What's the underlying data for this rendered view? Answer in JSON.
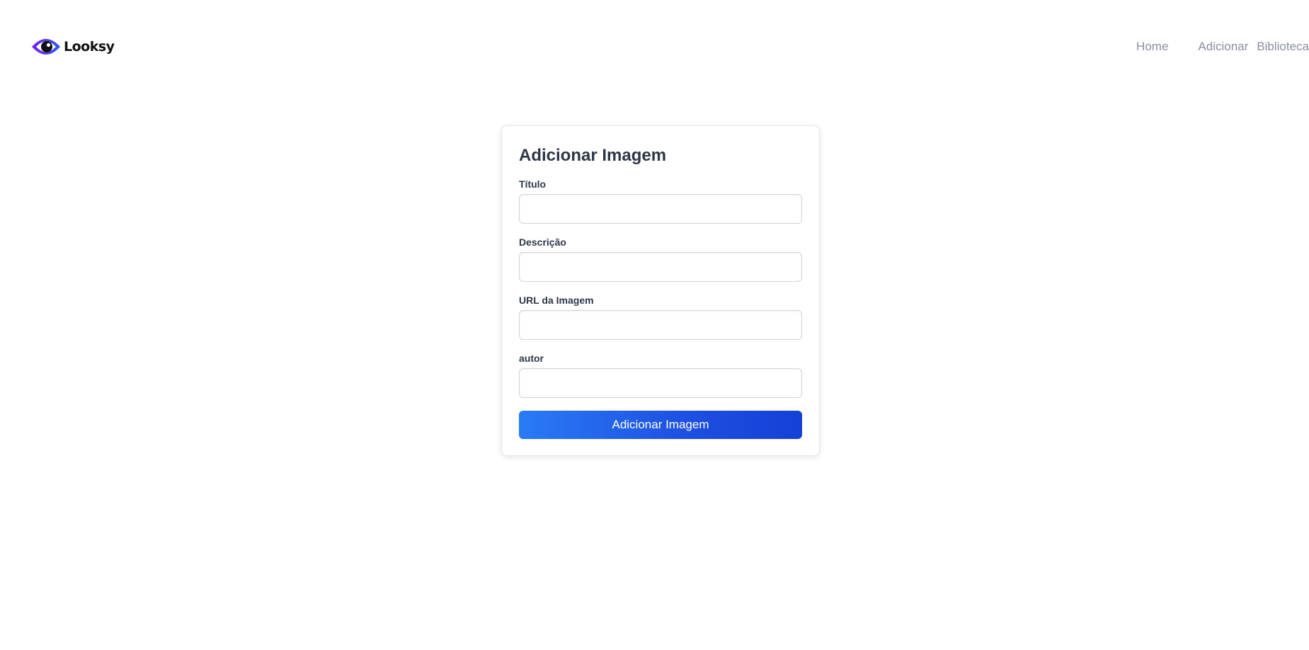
{
  "header": {
    "logo_text": "Looksy",
    "logo_icon": "eye-icon",
    "nav": [
      {
        "label": "Home"
      },
      {
        "label": "Adicionar"
      },
      {
        "label": "Biblioteca"
      }
    ]
  },
  "form": {
    "title": "Adicionar Imagem",
    "fields": [
      {
        "label": "Título",
        "value": "",
        "placeholder": ""
      },
      {
        "label": "Descrição",
        "value": "",
        "placeholder": ""
      },
      {
        "label": "URL da Imagem",
        "value": "",
        "placeholder": ""
      },
      {
        "label": "autor",
        "value": "",
        "placeholder": ""
      }
    ],
    "submit_label": "Adicionar Imagem"
  },
  "colors": {
    "brand_purple": "#6b2bf0",
    "brand_blue": "#2f5cf0",
    "button_start": "#2a7bf6",
    "button_end": "#1640d6",
    "nav_text": "#8a8f9e",
    "heading_text": "#2d3748"
  }
}
